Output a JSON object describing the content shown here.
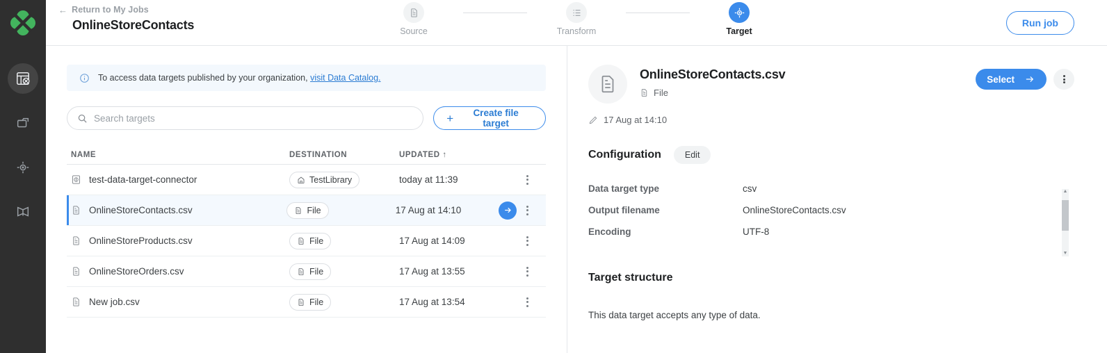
{
  "header": {
    "return_label": "Return to My Jobs",
    "job_title": "OnlineStoreContacts",
    "run_job_label": "Run job",
    "steps": [
      {
        "label": "Source",
        "icon": "document-icon",
        "active": false
      },
      {
        "label": "Transform",
        "icon": "list-icon",
        "active": false
      },
      {
        "label": "Target",
        "icon": "target-icon",
        "active": true
      }
    ]
  },
  "sidebar": {
    "logo": "clover-logo",
    "items": [
      {
        "name": "jobs-icon",
        "active": true
      },
      {
        "name": "folder-icon",
        "active": false
      },
      {
        "name": "target-icon",
        "active": false
      },
      {
        "name": "book-icon",
        "active": false
      }
    ]
  },
  "left_pane": {
    "banner": {
      "icon": "info-icon",
      "text": "To access data targets published by your organization,",
      "link": "visit Data Catalog."
    },
    "search": {
      "placeholder": "Search targets",
      "value": ""
    },
    "create_button": "Create file target",
    "table": {
      "columns": [
        "NAME",
        "DESTINATION",
        "UPDATED ↑"
      ],
      "rows": [
        {
          "name": "test-data-target-connector",
          "icon": "connector-icon",
          "destination": "TestLibrary",
          "destination_icon": "library-icon",
          "updated": "today at 11:39",
          "selected": false
        },
        {
          "name": "OnlineStoreContacts.csv",
          "icon": "file-icon",
          "destination": "File",
          "destination_icon": "file-icon",
          "updated": "17 Aug at 14:10",
          "selected": true
        },
        {
          "name": "OnlineStoreProducts.csv",
          "icon": "file-icon",
          "destination": "File",
          "destination_icon": "file-icon",
          "updated": "17 Aug at 14:09",
          "selected": false
        },
        {
          "name": "OnlineStoreOrders.csv",
          "icon": "file-icon",
          "destination": "File",
          "destination_icon": "file-icon",
          "updated": "17 Aug at 13:55",
          "selected": false
        },
        {
          "name": "New job.csv",
          "icon": "file-icon",
          "destination": "File",
          "destination_icon": "file-icon",
          "updated": "17 Aug at 13:54",
          "selected": false
        }
      ]
    }
  },
  "right_pane": {
    "title": "OnlineStoreContacts.csv",
    "subtitle": "File",
    "select_label": "Select",
    "edited_at": "17 Aug at 14:10",
    "configuration": {
      "heading": "Configuration",
      "edit_label": "Edit",
      "rows": [
        {
          "key": "Data target type",
          "value": "csv"
        },
        {
          "key": "Output filename",
          "value": "OnlineStoreContacts.csv"
        },
        {
          "key": "Encoding",
          "value": "UTF-8"
        }
      ]
    },
    "target_structure": {
      "heading": "Target structure",
      "text": "This data target accepts any type of data."
    }
  },
  "colors": {
    "accent": "#3b8beb",
    "rail": "#2f2f2f",
    "logo_green": "#43b45e",
    "banner_bg": "#f3f8fd"
  }
}
